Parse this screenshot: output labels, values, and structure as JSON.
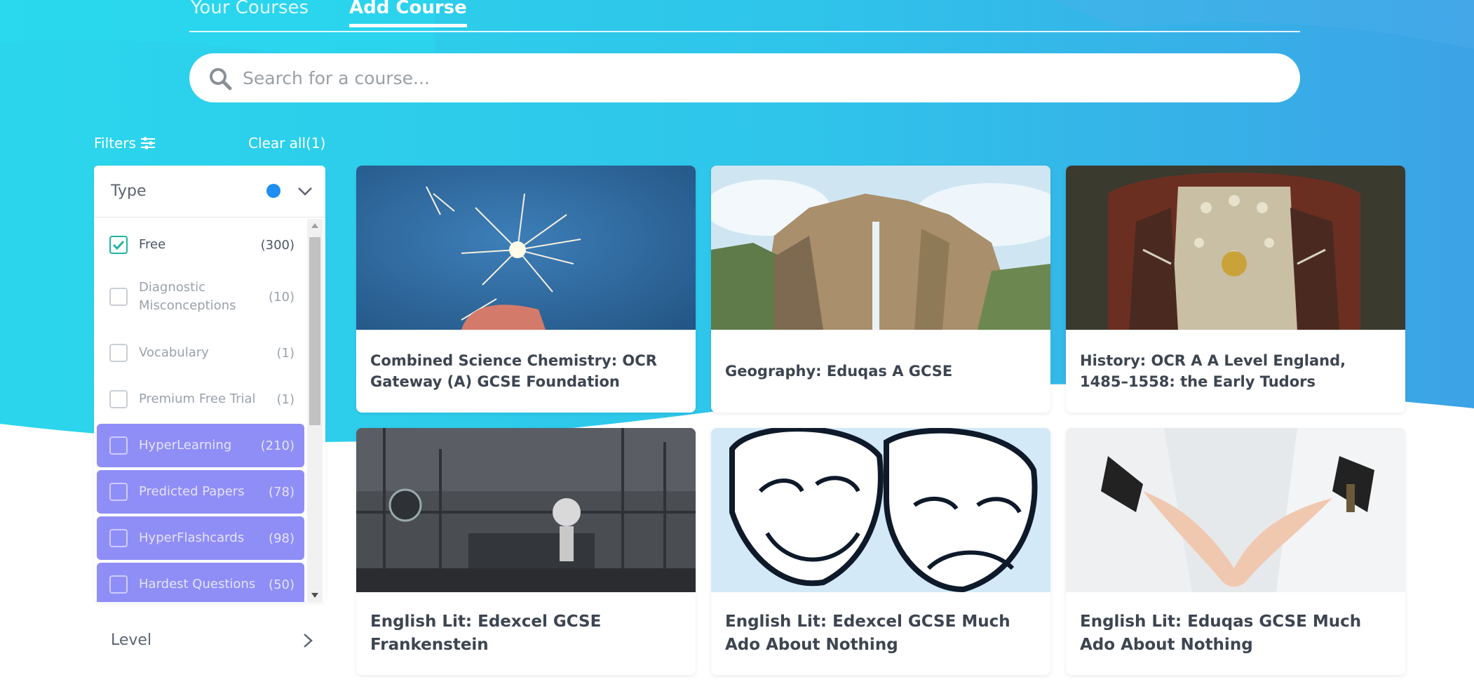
{
  "tabs": [
    {
      "label": "Your Courses"
    },
    {
      "label": "Add Course"
    }
  ],
  "search": {
    "placeholder": "Search for a course..."
  },
  "filters": {
    "label": "Filters",
    "clear_all": "Clear all(1)",
    "type_panel": {
      "title": "Type",
      "options": [
        {
          "label": "Free",
          "count": "(300)",
          "checked": true
        },
        {
          "label": "Diagnostic Misconceptions",
          "count": "(10)",
          "checked": false
        },
        {
          "label": "Vocabulary",
          "count": "(1)",
          "checked": false
        },
        {
          "label": "Premium Free Trial",
          "count": "(1)",
          "checked": false
        },
        {
          "label": "HyperLearning",
          "count": "(210)",
          "checked": false
        },
        {
          "label": "Predicted Papers",
          "count": "(78)",
          "checked": false
        },
        {
          "label": "HyperFlashcards",
          "count": "(98)",
          "checked": false
        },
        {
          "label": "Hardest Questions",
          "count": "(50)",
          "checked": false
        }
      ]
    },
    "level_panel": {
      "title": "Level"
    }
  },
  "courses": [
    {
      "title": "Combined Science Chemistry: OCR Gateway (A) GCSE Foundation",
      "image": "sparkler"
    },
    {
      "title": "Geography: Eduqas A GCSE",
      "image": "waterfall-cliffs"
    },
    {
      "title": "History: OCR A A Level England, 1485–1558: the Early Tudors",
      "image": "tudor-portrait"
    },
    {
      "title": "English Lit: Edexcel GCSE Frankenstein",
      "image": "laboratory"
    },
    {
      "title": "English Lit: Edexcel GCSE Much Ado About Nothing",
      "image": "theatre-masks"
    },
    {
      "title": "English Lit: Eduqas GCSE Much Ado About Nothing",
      "image": "wedding-hands"
    }
  ],
  "colors": {
    "bg_gradient_start": "#2bd3ea",
    "bg_gradient_end": "#3ba5e6",
    "filter_dot": "#1e8ef0",
    "purple_option": "#8f8ef7",
    "check_color": "#20b5a0"
  }
}
